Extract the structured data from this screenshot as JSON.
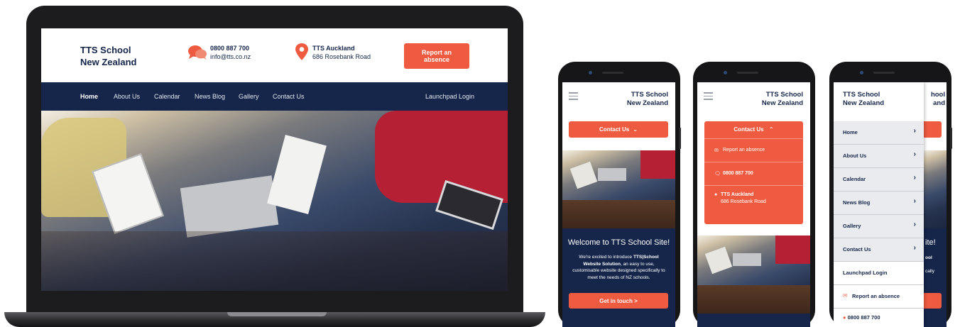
{
  "site": {
    "logo_line1": "TTS School",
    "logo_line2": "New Zealand",
    "phone": "0800 887 700",
    "email": "info@tts.co.nz",
    "location_name": "TTS Auckland",
    "address": "686 Rosebank Road",
    "report_button": "Report an absence"
  },
  "nav": {
    "items": [
      "Home",
      "About Us",
      "Calendar",
      "News Blog",
      "Gallery",
      "Contact Us"
    ],
    "login": "Launchpad Login"
  },
  "mobile": {
    "contact_button": "Contact Us",
    "dropdown": {
      "report": "Report an absence",
      "phone": "0800 887 700",
      "location": "TTS Auckland",
      "address": "686 Rosebank Road"
    },
    "welcome_title": "Welcome to TTS School Site!",
    "welcome_prefix": "We're excited to introduce",
    "welcome_brand": "TTS|School Website Solution",
    "welcome_suffix": ", an easy to use, customisable website designed specifically to meet the needs of NZ schools.",
    "cta": "Get in touch >",
    "menu_items": [
      "Home",
      "About Us",
      "Calendar",
      "News Blog",
      "Gallery",
      "Contact Us"
    ],
    "menu_login": "Launchpad Login",
    "menu_report": "Report an absence",
    "menu_phone": "0800 887 700",
    "peek": {
      "logo1": "hool",
      "logo2": "and",
      "title_fragment": "ite!",
      "text1": "ool",
      "text2": "cally"
    }
  },
  "colors": {
    "navy": "#15264a",
    "accent": "#ef5b40"
  }
}
